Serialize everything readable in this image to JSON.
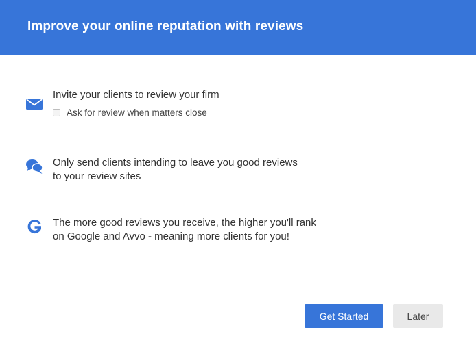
{
  "header": {
    "title": "Improve your online reputation with reviews"
  },
  "steps": [
    {
      "icon": "envelope-icon",
      "text": "Invite your clients to review your firm",
      "checkbox": {
        "label": "Ask for review when matters close",
        "checked": false
      }
    },
    {
      "icon": "chat-bubbles-icon",
      "line1": "Only send clients intending to leave you good reviews",
      "line2": "to your review sites"
    },
    {
      "icon": "google-icon",
      "line1": "The more good reviews you receive, the higher you'll rank",
      "line2": "on Google and Avvo - meaning more clients for you!"
    }
  ],
  "actions": {
    "primary_label": "Get Started",
    "secondary_label": "Later"
  },
  "colors": {
    "accent": "#3775d9",
    "secondary_button": "#e9e9e9",
    "text": "#333333"
  }
}
